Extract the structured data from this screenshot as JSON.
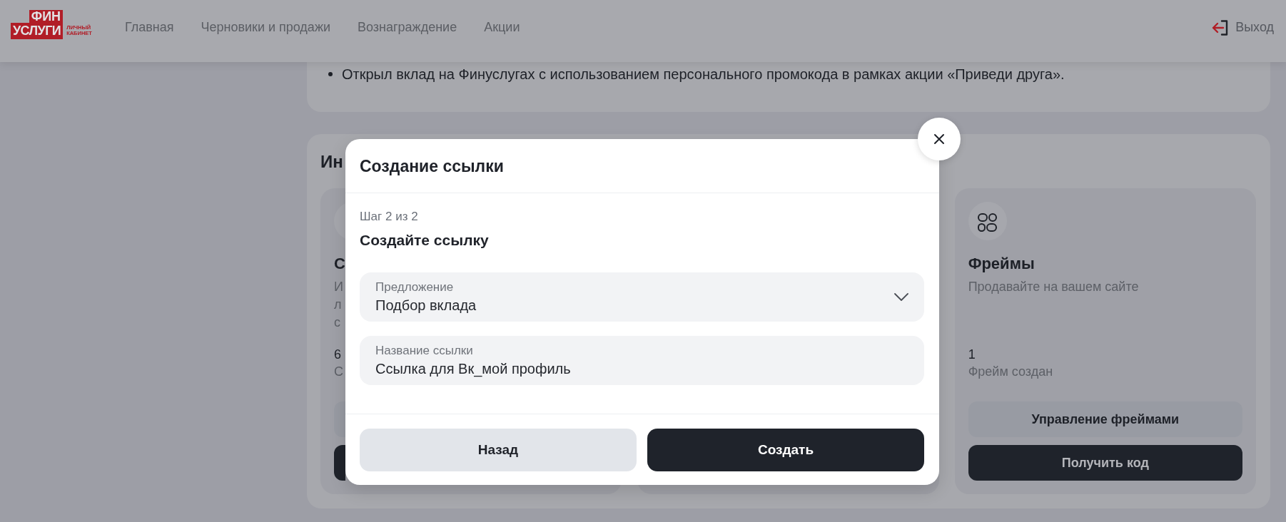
{
  "header": {
    "logo": {
      "top": "ФИН",
      "bottom": "УСЛУГИ",
      "caption": "ЛИЧНЫЙ КАБИНЕТ"
    },
    "nav": [
      "Главная",
      "Черновики и продажи",
      "Вознаграждение",
      "Акции"
    ],
    "exit": {
      "label": "Выход"
    }
  },
  "conditions_card": {
    "items": [
      "Открыл вклад на Финуслугах с использованием персонального промокода в рамках акции «Приведи друга»."
    ]
  },
  "tools_section": {
    "title": "Ин",
    "cards": [
      {
        "kind": "peek",
        "title": "С",
        "description_lines": [
          "И",
          "л",
          "с"
        ],
        "count": "6",
        "count_label": "С",
        "buttons": [
          {
            "kind": "secondary"
          },
          {
            "kind": "primary"
          }
        ]
      },
      {
        "kind": "covered"
      },
      {
        "kind": "full",
        "title": "Фреймы",
        "description_lines": [
          "Продавайте на вашем сайте"
        ],
        "count": "1",
        "count_label": "Фрейм создан",
        "buttons": [
          {
            "kind": "secondary",
            "label": "Управление фреймами"
          },
          {
            "kind": "primary",
            "label": "Получить код"
          }
        ]
      }
    ]
  },
  "modal": {
    "title": "Создание ссылки",
    "step": "Шаг 2 из 2",
    "subtitle": "Создайте ссылку",
    "fields": [
      {
        "kind": "select",
        "label": "Предложение",
        "value": "Подбор вклада"
      },
      {
        "kind": "text",
        "label": "Название ссылки",
        "value": "Ссылка для Вк_мой профиль"
      }
    ],
    "buttons": [
      {
        "kind": "secondary",
        "label": "Назад"
      },
      {
        "kind": "primary",
        "label": "Создать"
      }
    ]
  }
}
